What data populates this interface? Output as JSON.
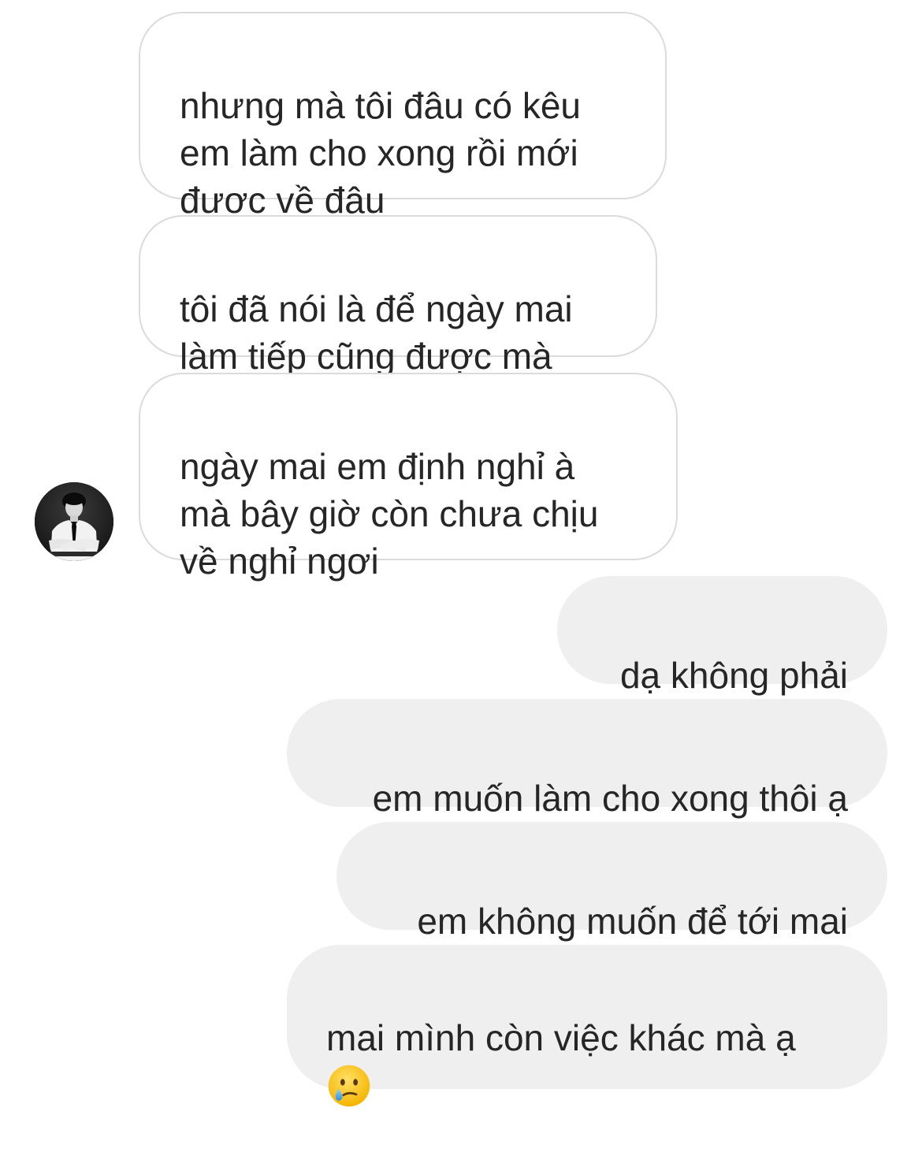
{
  "thread": {
    "incoming": [
      {
        "text": "nhưng mà tôi đâu có kêu\nem làm cho xong rồi mới\nđược về đâu"
      },
      {
        "text": "tôi đã nói là để ngày mai\nlàm tiếp cũng được mà"
      },
      {
        "text": "ngày mai em định nghỉ à\nmà bây giờ còn chưa chịu\nvề nghỉ ngơi"
      }
    ],
    "outgoing": [
      {
        "text": "dạ không phải"
      },
      {
        "text": "em muốn làm cho xong thôi ạ"
      },
      {
        "text": "em không muốn để tới mai"
      },
      {
        "text": "mai mình còn việc khác mà ạ"
      }
    ],
    "last_emoji": "sad-tear-face-icon"
  },
  "colors": {
    "incoming_bg": "#ffffff",
    "incoming_border": "#dbdbdb",
    "outgoing_bg": "#efefef",
    "text": "#262626"
  }
}
